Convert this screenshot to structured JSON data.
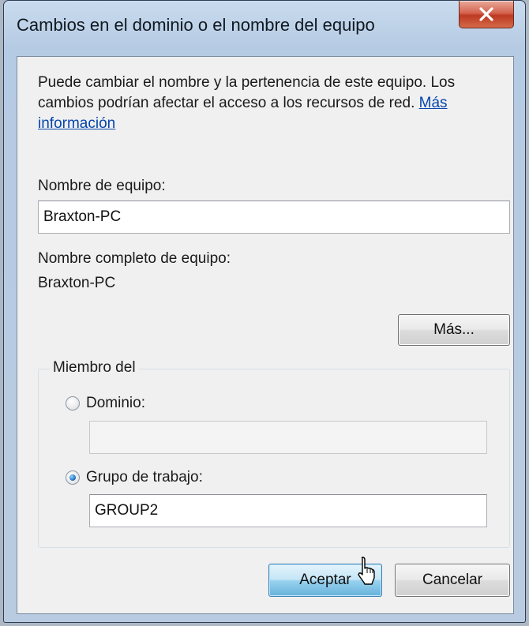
{
  "window": {
    "title": "Cambios en el dominio o el nombre del equipo",
    "close_label": "X"
  },
  "description": {
    "text": "Puede cambiar el nombre y la pertenencia de este equipo. Los cambios podrían afectar el acceso a los recursos de red. ",
    "link": "Más información"
  },
  "computer_name": {
    "label": "Nombre de equipo:",
    "value": "Braxton-PC"
  },
  "full_name": {
    "label": "Nombre completo de equipo:",
    "value": "Braxton-PC"
  },
  "more_button": "Más...",
  "member_of": {
    "legend": "Miembro del",
    "domain": {
      "label": "Dominio:",
      "value": "",
      "selected": false
    },
    "workgroup": {
      "label": "Grupo de trabajo:",
      "value": "GROUP2",
      "selected": true
    }
  },
  "buttons": {
    "ok": "Aceptar",
    "cancel": "Cancelar"
  },
  "colors": {
    "link": "#0645ad",
    "close_button": "#c8452c",
    "default_button_border": "#3c7fb1"
  }
}
